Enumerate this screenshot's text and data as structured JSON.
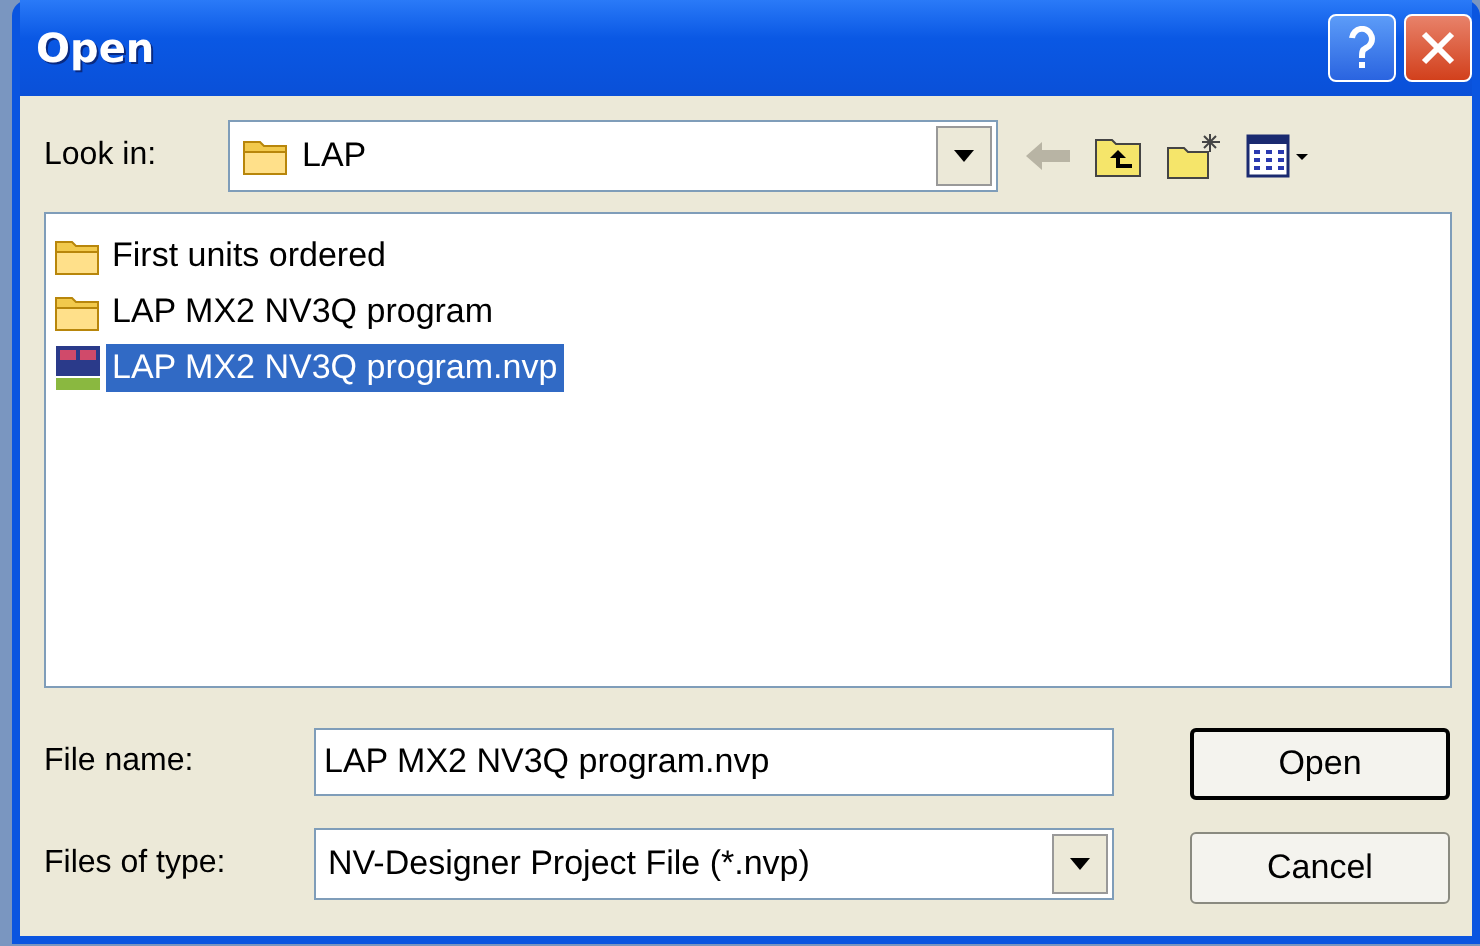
{
  "window": {
    "title": "Open"
  },
  "look_in": {
    "label": "Look in:",
    "value": "LAP"
  },
  "files": [
    {
      "name": "First units ordered",
      "kind": "folder",
      "selected": false
    },
    {
      "name": "LAP MX2 NV3Q program",
      "kind": "folder",
      "selected": false
    },
    {
      "name": "LAP MX2 NV3Q program.nvp",
      "kind": "project",
      "selected": true
    }
  ],
  "file_name": {
    "label": "File name:",
    "value": "LAP MX2 NV3Q program.nvp"
  },
  "file_type": {
    "label": "Files of type:",
    "value": "NV-Designer Project File (*.nvp)"
  },
  "buttons": [
    {
      "label": "Open",
      "default": true
    },
    {
      "label": "Cancel",
      "default": false
    }
  ]
}
